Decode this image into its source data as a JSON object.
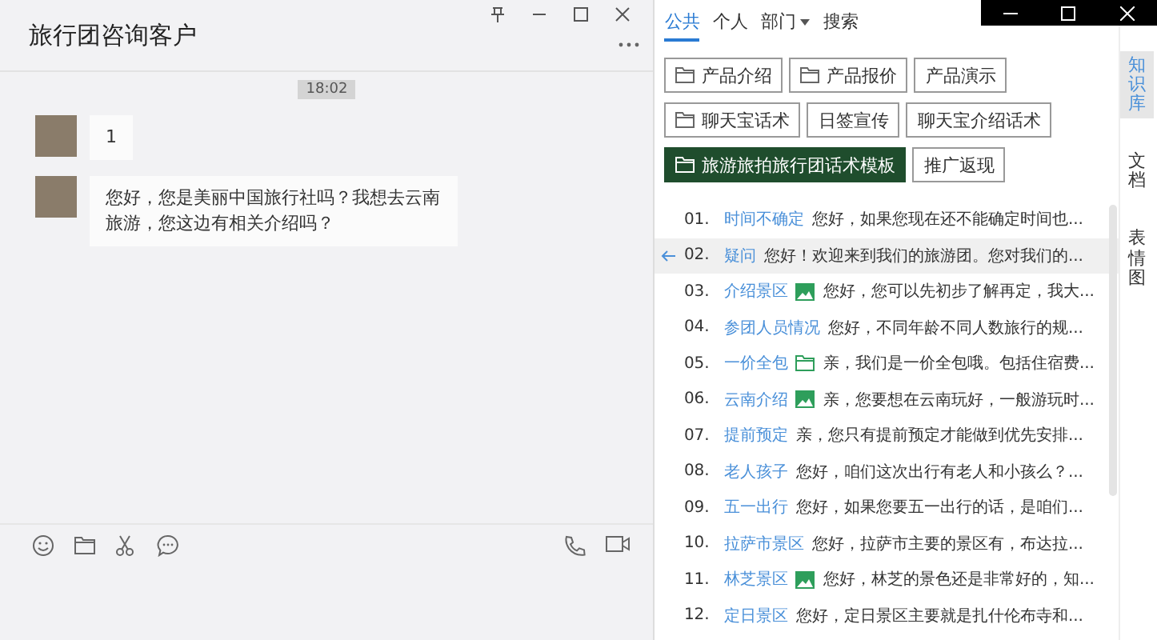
{
  "chat": {
    "title": "旅行团咨询客户",
    "time": "18:02",
    "messages": [
      {
        "text": "1"
      },
      {
        "text": "您好，您是美丽中国旅行社吗？我想去云南旅游，您这边有相关介绍吗？"
      }
    ]
  },
  "panel": {
    "tabs": [
      {
        "label": "公共",
        "selected": true,
        "dropdown": false
      },
      {
        "label": "个人",
        "selected": false,
        "dropdown": false
      },
      {
        "label": "部门",
        "selected": false,
        "dropdown": true
      },
      {
        "label": "搜索",
        "selected": false,
        "dropdown": false
      }
    ],
    "folders": [
      [
        {
          "label": "产品介绍",
          "folder": true,
          "selected": false
        },
        {
          "label": "产品报价",
          "folder": true,
          "selected": false
        },
        {
          "label": "产品演示",
          "folder": false,
          "selected": false
        }
      ],
      [
        {
          "label": "聊天宝话术",
          "folder": true,
          "selected": false
        },
        {
          "label": "日签宣传",
          "folder": false,
          "selected": false
        },
        {
          "label": "聊天宝介绍话术",
          "folder": false,
          "selected": false
        }
      ],
      [
        {
          "label": "旅游旅拍旅行团话术模板",
          "folder": true,
          "selected": true
        },
        {
          "label": "推广返现",
          "folder": false,
          "selected": false
        }
      ]
    ],
    "items": [
      {
        "num": "01.",
        "title": "时间不确定",
        "kind": "text",
        "text": "您好，如果您现在还不能确定时间也...",
        "selected": false
      },
      {
        "num": "02.",
        "title": "疑问",
        "kind": "text",
        "text": "您好！欢迎来到我们的旅游团。您对我们的...",
        "selected": true
      },
      {
        "num": "03.",
        "title": "介绍景区",
        "kind": "image",
        "text": "您好，您可以先初步了解再定，我大...",
        "selected": false
      },
      {
        "num": "04.",
        "title": "参团人员情况",
        "kind": "text",
        "text": "您好，不同年龄不同人数旅行的规...",
        "selected": false
      },
      {
        "num": "05.",
        "title": "一价全包",
        "kind": "folder",
        "text": "亲，我们是一价全包哦。包括住宿费...",
        "selected": false
      },
      {
        "num": "06.",
        "title": "云南介绍",
        "kind": "image",
        "text": "亲，您要想在云南玩好，一般游玩时...",
        "selected": false
      },
      {
        "num": "07.",
        "title": "提前预定",
        "kind": "text",
        "text": "亲，您只有提前预定才能做到优先安排...",
        "selected": false
      },
      {
        "num": "08.",
        "title": "老人孩子",
        "kind": "text",
        "text": "您好，咱们这次出行有老人和小孩么？...",
        "selected": false
      },
      {
        "num": "09.",
        "title": "五一出行",
        "kind": "text",
        "text": "您好，如果您要五一出行的话，是咱们...",
        "selected": false
      },
      {
        "num": "10.",
        "title": "拉萨市景区",
        "kind": "text",
        "text": "您好，拉萨市主要的景区有，布达拉...",
        "selected": false
      },
      {
        "num": "11.",
        "title": "林芝景区",
        "kind": "image",
        "text": "您好，林芝的景色还是非常好的，知...",
        "selected": false
      },
      {
        "num": "12.",
        "title": "定日景区",
        "kind": "text",
        "text": "您好，定日景区主要就是扎什伦布寺和...",
        "selected": false
      }
    ],
    "side_tabs": [
      {
        "label": "知识库",
        "selected": true
      },
      {
        "label": "文档",
        "selected": false
      },
      {
        "label": "表情图",
        "selected": false
      }
    ]
  }
}
